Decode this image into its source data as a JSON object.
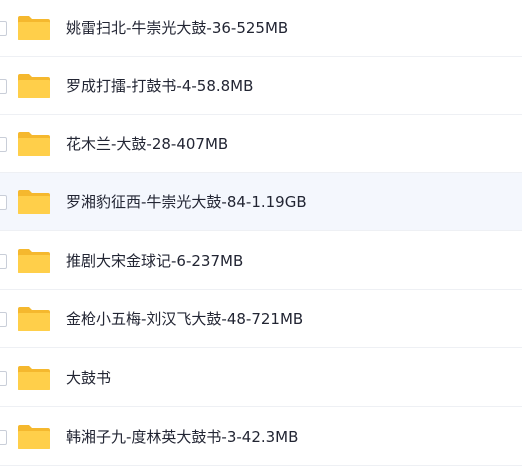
{
  "colors": {
    "folder_back": "#f5b82e",
    "folder_front": "#ffcf4a",
    "text": "#222533",
    "row_divider": "#eef0f4",
    "row_highlight": "#f4f7fd"
  },
  "files": [
    {
      "name": "姚雷扫北-牛崇光大鼓-36-525MB",
      "icon": "folder-icon",
      "highlighted": false
    },
    {
      "name": "罗成打擂-打鼓书-4-58.8MB",
      "icon": "folder-icon",
      "highlighted": false
    },
    {
      "name": "花木兰-大鼓-28-407MB",
      "icon": "folder-icon",
      "highlighted": false
    },
    {
      "name": "罗湘豹征西-牛崇光大鼓-84-1.19GB",
      "icon": "folder-icon",
      "highlighted": true
    },
    {
      "name": "推剧大宋金球记-6-237MB",
      "icon": "folder-icon",
      "highlighted": false
    },
    {
      "name": "金枪小五梅-刘汉飞大鼓-48-721MB",
      "icon": "folder-icon",
      "highlighted": false
    },
    {
      "name": "大鼓书",
      "icon": "folder-icon",
      "highlighted": false
    },
    {
      "name": "韩湘子九-度林英大鼓书-3-42.3MB",
      "icon": "folder-icon",
      "highlighted": false
    }
  ]
}
